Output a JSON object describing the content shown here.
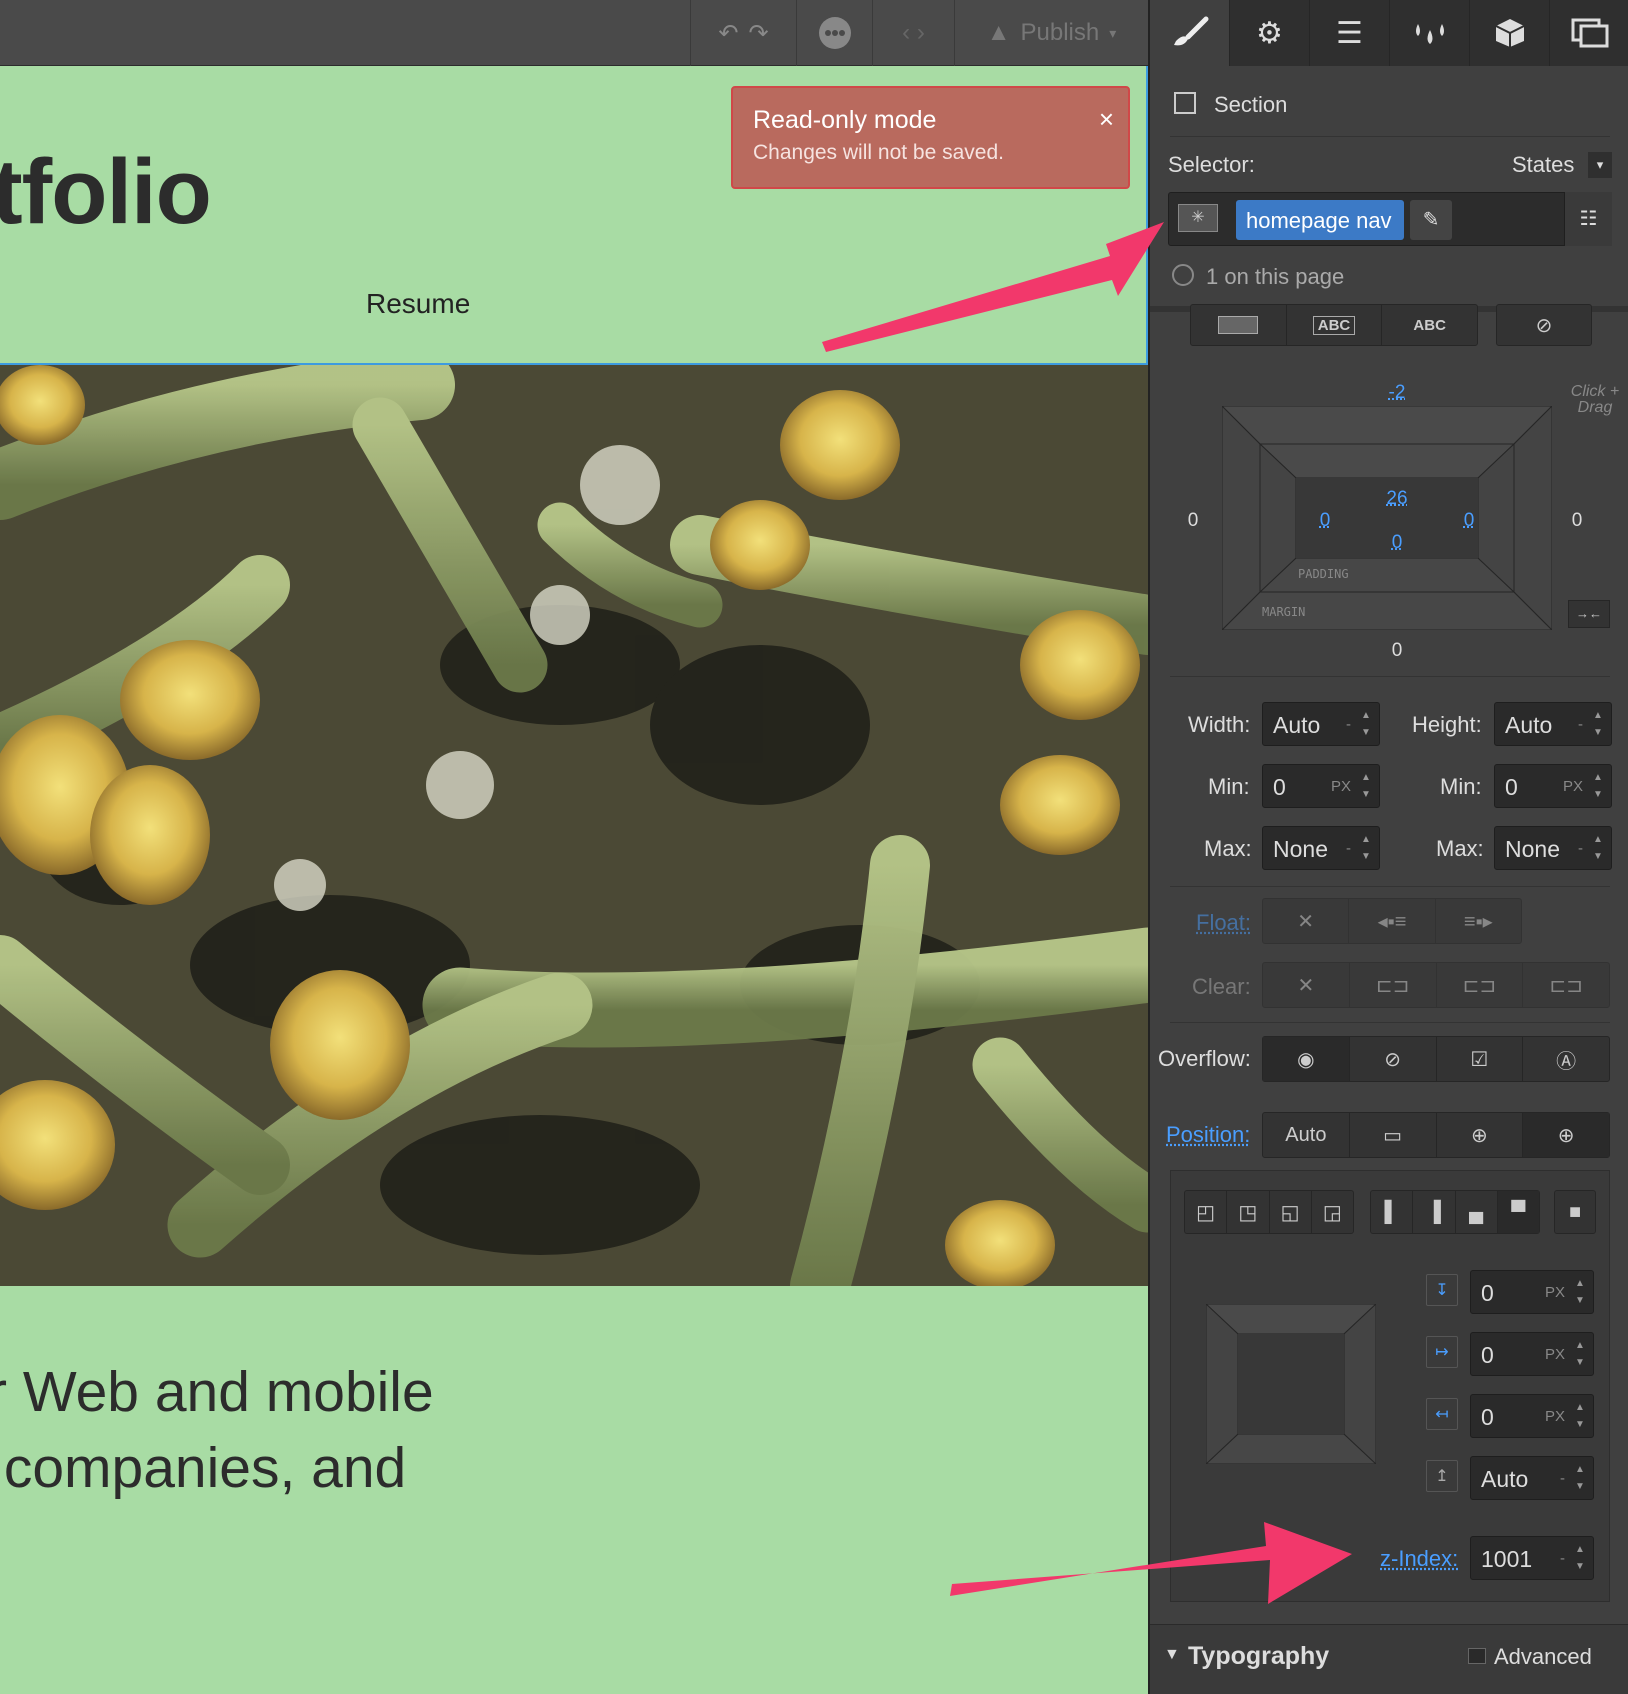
{
  "topbar": {
    "publish": "Publish",
    "undo_icon": "undo-icon",
    "redo_icon": "redo-icon",
    "comments_icon": "comments-icon",
    "code_icon": "code-icon",
    "publish_icon": "rocket-icon"
  },
  "canvas": {
    "title": "tfolio",
    "nav_link": "Resume",
    "body_line1": "r Web and mobile",
    "body_line2": " companies, and"
  },
  "toast": {
    "title": "Read-only mode",
    "message": "Changes will not be saved.",
    "close": "×"
  },
  "panel": {
    "tabs": [
      "brush-icon",
      "gear-icon",
      "navigator-icon",
      "drops-icon",
      "box-icon",
      "assets-icon"
    ],
    "element_type": "Section",
    "selector_label": "Selector:",
    "states_label": "States",
    "class_name": "homepage nav",
    "count_text": "1 on this page",
    "display_opts": [
      "block",
      "ABC",
      "ABC",
      "hidden"
    ],
    "margin": {
      "top": "-2",
      "right": "0",
      "bottom": "0",
      "left": "0",
      "label": "MARGIN"
    },
    "padding": {
      "top": "26",
      "right": "0",
      "bottom": "0",
      "left": "0",
      "label": "PADDING"
    },
    "hint": "Click + Drag",
    "width_label": "Width:",
    "width_value": "Auto",
    "height_label": "Height:",
    "height_value": "Auto",
    "min_label": "Min:",
    "min_w": "0",
    "min_h": "0",
    "max_label": "Max:",
    "max_w": "None",
    "max_h": "None",
    "unit": "PX",
    "dash": "-",
    "float_label": "Float:",
    "clear_label": "Clear:",
    "overflow_label": "Overflow:",
    "position_label": "Position:",
    "position_auto": "Auto",
    "pos_top": "0",
    "pos_left": "0",
    "pos_right": "0",
    "pos_bottom": "Auto",
    "zindex_label": "z-Index:",
    "zindex_value": "1001",
    "typography_label": "Typography",
    "advanced_label": "Advanced"
  },
  "colors": {
    "canvas_bg": "#a8dca4",
    "toast_bg": "#b96a5e",
    "selector_tag": "#3c7ac6",
    "annotation_arrow": "#f2386b",
    "accent": "#4a9eff"
  }
}
